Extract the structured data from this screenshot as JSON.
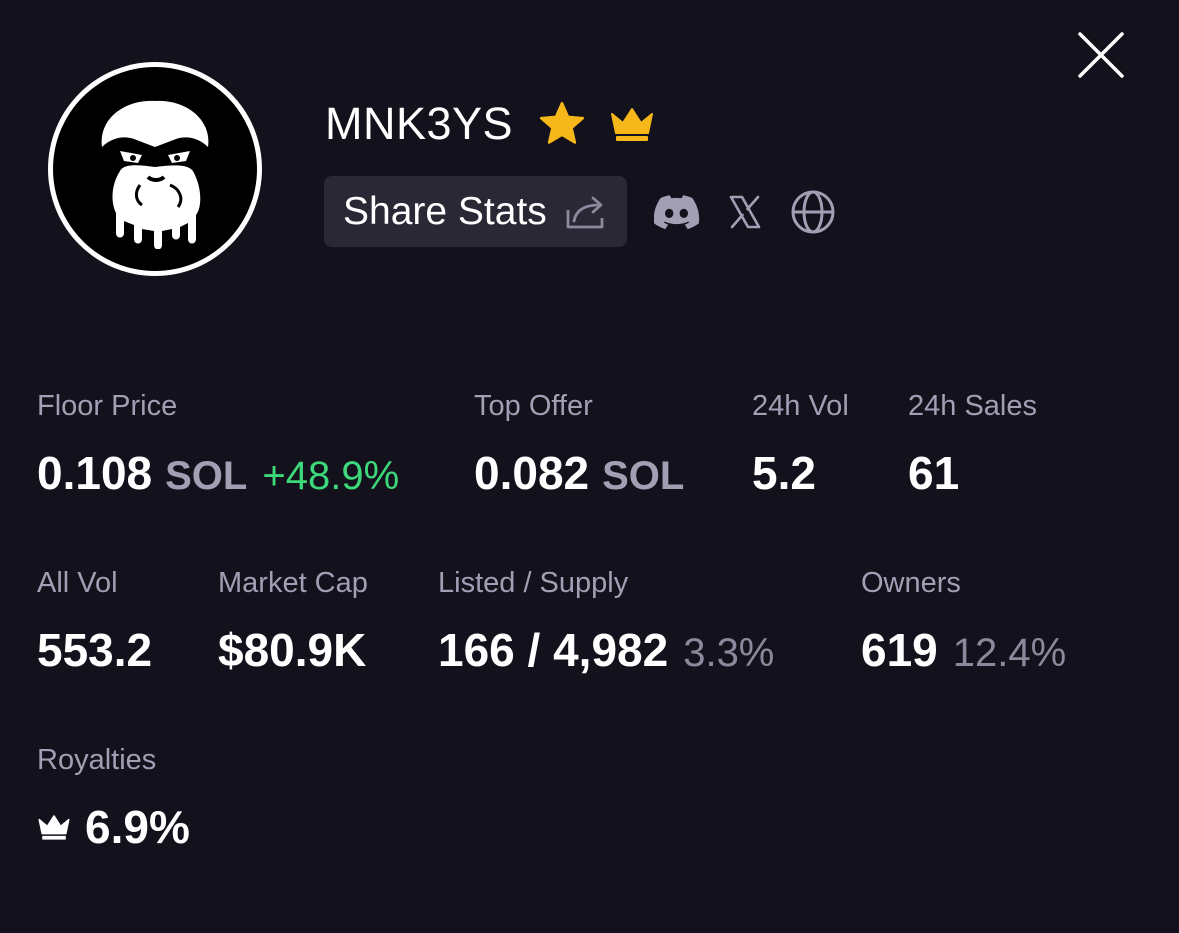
{
  "collection": {
    "name": "MNK3YS",
    "badges": [
      "star-icon",
      "crown-icon"
    ],
    "accent_color": "#f5b719"
  },
  "actions": {
    "share_label": "Share Stats",
    "socials": [
      "discord-icon",
      "x-icon",
      "globe-icon"
    ]
  },
  "stats": {
    "floor_price": {
      "label": "Floor Price",
      "value": "0.108",
      "unit": "SOL",
      "change": "+48.9%"
    },
    "top_offer": {
      "label": "Top Offer",
      "value": "0.082",
      "unit": "SOL"
    },
    "vol_24h": {
      "label": "24h Vol",
      "value": "5.2"
    },
    "sales_24h": {
      "label": "24h Sales",
      "value": "61"
    },
    "all_vol": {
      "label": "All Vol",
      "value": "553.2"
    },
    "market_cap": {
      "label": "Market Cap",
      "value": "$80.9K"
    },
    "listed_supply": {
      "label": "Listed / Supply",
      "value": "166 / 4,982",
      "pct": "3.3%"
    },
    "owners": {
      "label": "Owners",
      "value": "619",
      "pct": "12.4%"
    },
    "royalties": {
      "label": "Royalties",
      "value": "6.9%"
    }
  },
  "colors": {
    "background": "#13111c",
    "positive": "#3dd879",
    "muted": "#a29fb5",
    "button_bg": "#2a2835"
  }
}
